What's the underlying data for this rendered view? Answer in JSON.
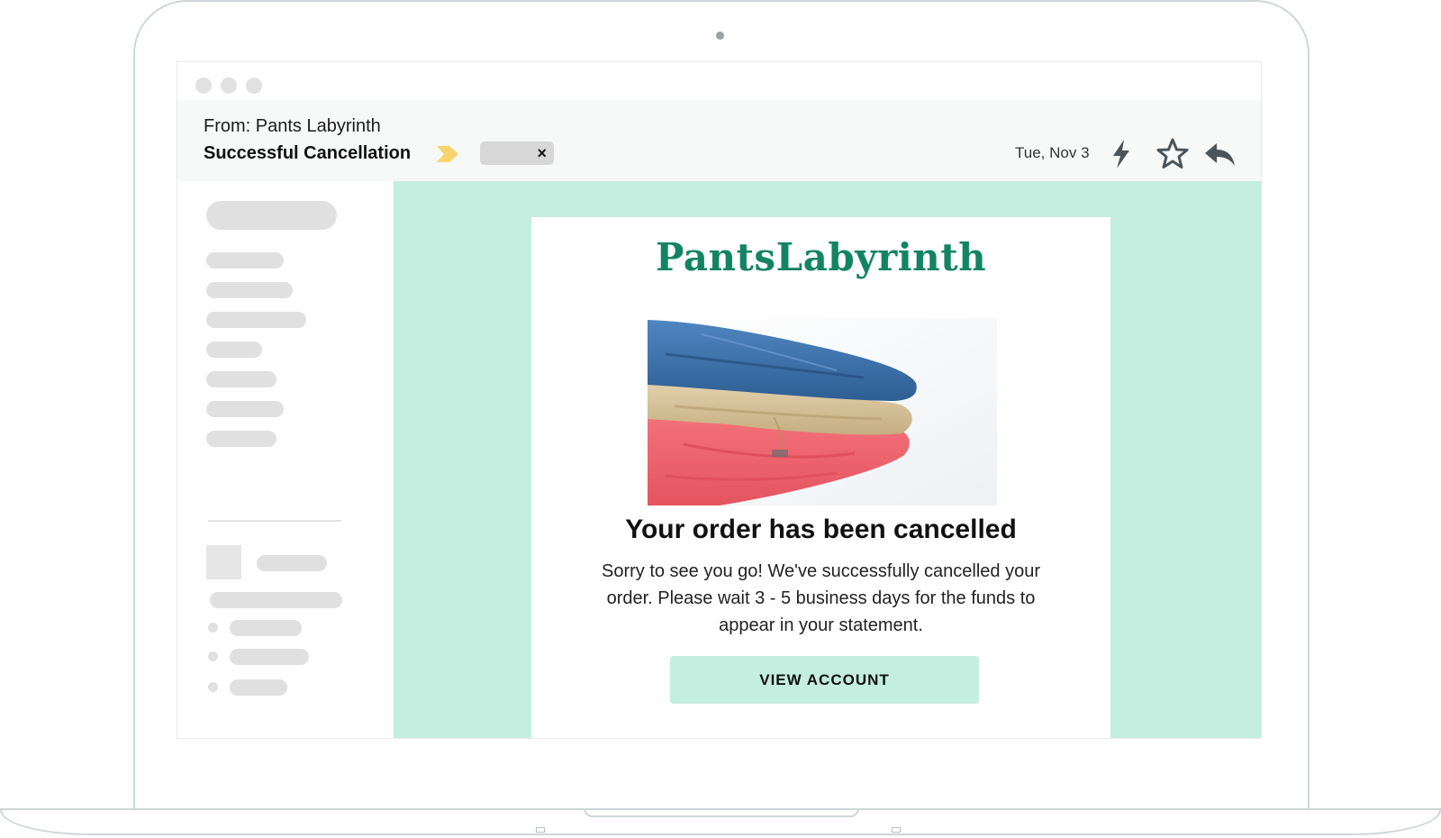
{
  "email": {
    "from": "From: Pants Labyrinth",
    "subject": "Successful Cancellation",
    "date": "Tue, Nov 3",
    "label_chip_close": "×"
  },
  "icons": {
    "important": "important-marker-icon",
    "quick_action": "lightning-icon",
    "star": "star-icon",
    "reply": "reply-icon"
  },
  "message": {
    "brand": "PantsLabyrinth",
    "hero_image": "folded-pants-stack",
    "headline": "Your order has been cancelled",
    "body": "Sorry to see you go! We've successfully cancelled your order. Please wait 3 - 5 business days for the funds to appear in your statement.",
    "cta_label": "VIEW ACCOUNT"
  },
  "colors": {
    "brand_green": "#138462",
    "mint_background": "#c4eee0",
    "important_yellow": "#f9d36b",
    "skeleton_gray": "#e0e0e0"
  }
}
